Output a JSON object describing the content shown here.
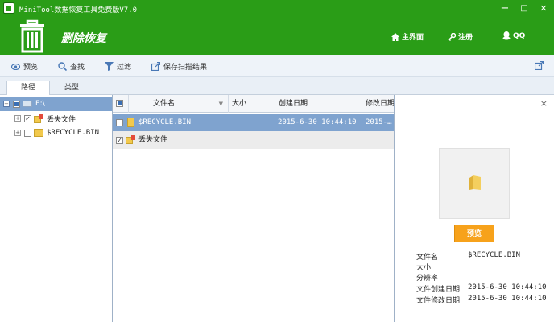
{
  "window": {
    "title": "MiniTool数据恢复工具免费版V7.0",
    "minimize": "−",
    "maximize": "□",
    "close": "✕"
  },
  "header": {
    "title": "删除恢复",
    "nav": [
      {
        "label": "主界面",
        "icon": "home-icon"
      },
      {
        "label": "注册",
        "icon": "key-icon"
      },
      {
        "label": "QQ",
        "icon": "qq-icon"
      }
    ]
  },
  "toolbar": {
    "items": [
      {
        "label": "预览",
        "icon": "eye-icon"
      },
      {
        "label": "查找",
        "icon": "search-icon"
      },
      {
        "label": "过滤",
        "icon": "filter-icon"
      },
      {
        "label": "保存扫描结果",
        "icon": "export-icon"
      }
    ],
    "right_icon": "share-icon"
  },
  "tabs": [
    {
      "label": "路径",
      "active": true
    },
    {
      "label": "类型",
      "active": false
    }
  ],
  "tree": {
    "root": {
      "label": "E:\\"
    },
    "children": [
      {
        "label": "丢失文件",
        "checked": true
      },
      {
        "label": "$RECYCLE.BIN",
        "checked": false
      }
    ]
  },
  "filelist": {
    "columns": [
      "文件名",
      "大小",
      "创建日期",
      "修改日期"
    ],
    "rows": [
      {
        "name": "$RECYCLE.BIN",
        "size": "",
        "created": "2015-6-30 10:44:10",
        "modified": "2015-…",
        "selected": true,
        "checked": false
      },
      {
        "name": "丢失文件",
        "size": "",
        "created": "",
        "modified": "",
        "selected": false,
        "checked": true
      }
    ]
  },
  "preview": {
    "close": "×",
    "button": "预览",
    "props": [
      {
        "label": "文件名",
        "value": "$RECYCLE.BIN"
      },
      {
        "label": "大小:",
        "value": ""
      },
      {
        "label": "分辨率",
        "value": ""
      },
      {
        "label": "文件创建日期:",
        "value": "2015-6-30 10:44:10"
      },
      {
        "label": "文件修改日期",
        "value": "2015-6-30 10:44:10"
      }
    ]
  },
  "colors": {
    "brand_green": "#2a9d17",
    "selection_blue": "#7fa3cf",
    "preview_orange": "#f7a21b"
  }
}
